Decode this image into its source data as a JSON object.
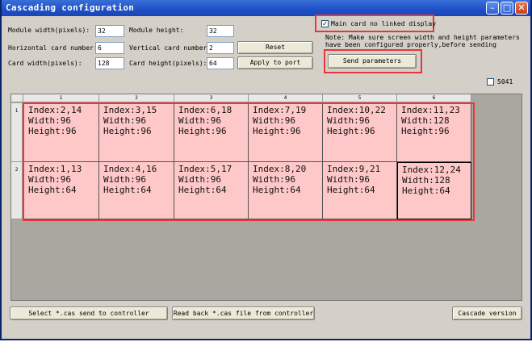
{
  "window": {
    "title": "Cascading configuration"
  },
  "form": {
    "module_width_label": "Module width(pixels):",
    "module_width": "32",
    "module_height_label": "Module height:",
    "module_height": "32",
    "h_cards_label": "Horizontal card number:",
    "h_cards": "6",
    "v_cards_label": "Vertical card number:",
    "v_cards": "2",
    "card_width_label": "Card width(pixels):",
    "card_width": "128",
    "card_height_label": "Card height(pixels):",
    "card_height": "64",
    "reset": "Reset",
    "apply": "Apply to port"
  },
  "right": {
    "main_card_label": "Main card no linked display",
    "main_card_checked": "✓",
    "note": "Note: Make sure screen width and height parameters have been configured properly,before sending cascading parameters.",
    "send": "Send parameters",
    "c5041_label": "5041"
  },
  "grid": {
    "columns": [
      "1",
      "2",
      "3",
      "4",
      "5",
      "6"
    ],
    "rows": [
      "1",
      "2"
    ],
    "cells": [
      [
        "Index:2,14\nWidth:96\nHeight:96",
        "Index:3,15\nWidth:96\nHeight:96",
        "Index:6,18\nWidth:96\nHeight:96",
        "Index:7,19\nWidth:96\nHeight:96",
        "Index:10,22\nWidth:96\nHeight:96",
        "Index:11,23\nWidth:128\nHeight:96"
      ],
      [
        "Index:1,13\nWidth:96\nHeight:64",
        "Index:4,16\nWidth:96\nHeight:64",
        "Index:5,17\nWidth:96\nHeight:64",
        "Index:8,20\nWidth:96\nHeight:64",
        "Index:9,21\nWidth:96\nHeight:64",
        "Index:12,24\nWidth:128\nHeight:64"
      ]
    ]
  },
  "bottom": {
    "select_cas": "Select *.cas send to controller",
    "read_back": "Read back *.cas file from controller",
    "version": "Cascade version"
  },
  "colors": {
    "cell_bg": "#ffc8c8",
    "highlight": "#e8363a",
    "title_bar": "#1e50c8"
  }
}
